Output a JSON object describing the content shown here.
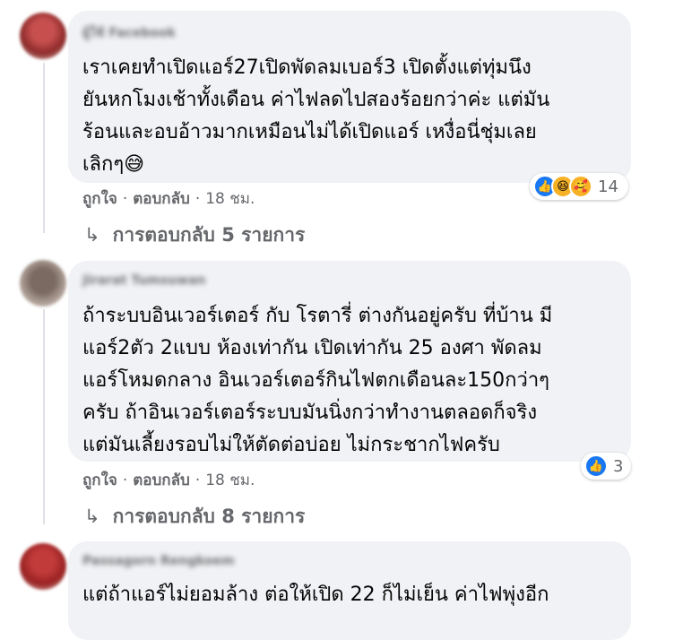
{
  "comments": [
    {
      "author": "ผู้ใช้ Facebook",
      "text": "เราเคยทำเปิดแอร์27เปิดพัดลมเบอร์3 เปิดตั้งแต่ทุ่มนึง\nยันหกโมงเช้าทั้งเดือน ค่าไฟลดไปสองร้อยกว่าค่ะ แต่มัน\nร้อนและอบอ้าวมากเหมือนไม่ได้เปิดแอร์ เหงื่อนี่ชุ่มเลย\nเลิกๆ😅",
      "like_label": "ถูกใจ",
      "reply_label": "ตอบกลับ",
      "time": "18 ชม.",
      "reaction_count": "14",
      "reactions": [
        "like-icon",
        "haha-icon",
        "care-icon"
      ],
      "replies_text": "การตอบกลับ 5 รายการ"
    },
    {
      "author": "Jirarat Tumsuwan",
      "text": "ถ้าระบบอินเวอร์เตอร์ กับ โรตารี่ ต่างกันอยู่ครับ ที่บ้าน มี\nแอร์2ตัว 2แบบ ห้องเท่ากัน เปิดเท่ากัน 25 องศา พัดลม\nแอร์โหมดกลาง อินเวอร์เตอร์กินไฟตกเดือนละ150กว่าๆ\nครับ ถ้าอินเวอร์เตอร์ระบบมันนิ่งกว่าทำงานตลอดก็จริง\nแต่มันเลี้ยงรอบไม่ให้ตัดต่อบ่อย ไม่กระชากไฟครับ",
      "like_label": "ถูกใจ",
      "reply_label": "ตอบกลับ",
      "time": "18 ชม.",
      "reaction_count": "3",
      "reactions": [
        "like-icon"
      ],
      "replies_text": "การตอบกลับ 8 รายการ"
    },
    {
      "author": "Passagorn Rengkoem",
      "text": "แต่ถ้าแอร์ไม่ยอมล้าง ต่อให้เปิด 22 ก็ไม่เย็น ค่าไฟพุ่งอีก"
    }
  ],
  "reply_arrow": "↳",
  "like_glyph": "👍",
  "haha_glyph": "😆",
  "care_glyph": "🥰",
  "colors": {
    "bubble": "#f0f2f5",
    "secondary_text": "#65676b",
    "like_blue": "#1877f2"
  }
}
